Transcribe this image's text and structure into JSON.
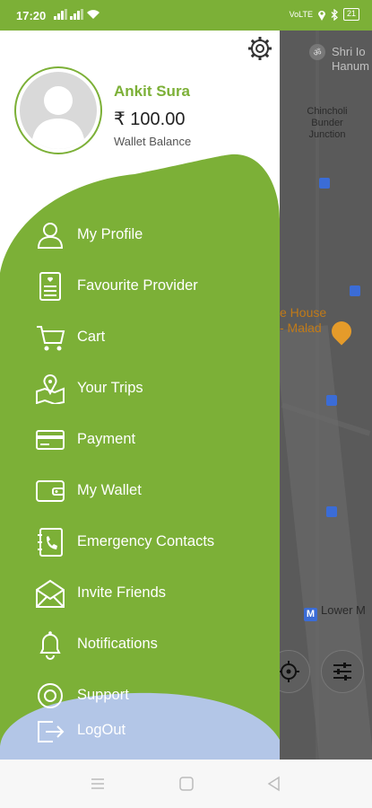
{
  "status_bar": {
    "time": "17:20",
    "battery": "21",
    "network_label": "VoLTE"
  },
  "drawer": {
    "user_name": "Ankit Sura",
    "wallet_amount": "₹ 100.00",
    "wallet_label": "Wallet Balance",
    "menu": [
      {
        "label": "My Profile",
        "icon": "user-icon"
      },
      {
        "label": "Favourite Provider",
        "icon": "favourite-list-icon"
      },
      {
        "label": "Cart",
        "icon": "cart-icon"
      },
      {
        "label": "Your Trips",
        "icon": "map-pin-icon"
      },
      {
        "label": "Payment",
        "icon": "card-icon"
      },
      {
        "label": "My Wallet",
        "icon": "wallet-icon"
      },
      {
        "label": "Emergency Contacts",
        "icon": "phone-book-icon"
      },
      {
        "label": "Invite Friends",
        "icon": "envelope-icon"
      },
      {
        "label": "Notifications",
        "icon": "bell-icon"
      },
      {
        "label": "Support",
        "icon": "support-icon"
      }
    ],
    "logout_label": "LogOut"
  },
  "map": {
    "labels": {
      "temple": "Shri Io Hanum",
      "junction": "Chincholi Bunder Junction",
      "place": "e House - Malad",
      "lower": "Lower M"
    },
    "metro_letter": "M"
  },
  "colors": {
    "accent": "#7cb037",
    "logout_blob": "#b3c6e7",
    "map_overlay": "#5a5a5a"
  }
}
